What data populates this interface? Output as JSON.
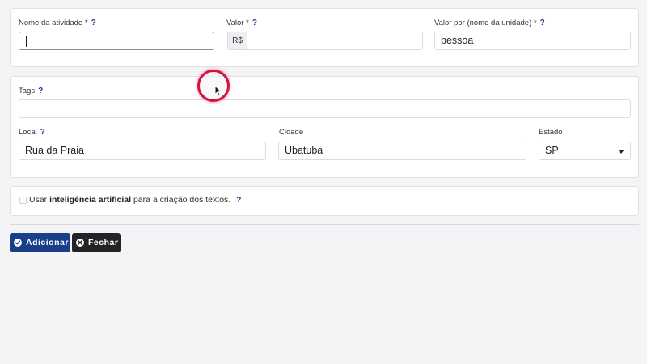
{
  "fields": {
    "activity_name": {
      "label": "Nome da atividade *",
      "help": "?",
      "value": ""
    },
    "price": {
      "label": "Valor *",
      "help": "?",
      "prefix": "R$",
      "value": ""
    },
    "price_per_unit": {
      "label": "Valor por (nome da unidade) *",
      "help": "?",
      "value": "pessoa"
    },
    "tags": {
      "label": "Tags",
      "help": "?",
      "value": ""
    },
    "location": {
      "label": "Local",
      "help": "?",
      "value": "Rua da Praia"
    },
    "city": {
      "label": "Cidade",
      "value": "Ubatuba"
    },
    "state": {
      "label": "Estado",
      "value": "SP"
    }
  },
  "ai_option": {
    "prefix": "Usar ",
    "bold": "inteligência artificial",
    "suffix": " para a criação dos textos.",
    "help": "?",
    "checked": false
  },
  "buttons": {
    "add_label": "Adicionar",
    "close_label": "Fechar"
  },
  "icons": {
    "add": "check-circle-icon",
    "close": "x-circle-icon",
    "cursor": "mouse-pointer-icon"
  },
  "colors": {
    "primary": "#1a3e8a",
    "dark_button": "#232325",
    "cursor_ring": "#d4123c"
  }
}
